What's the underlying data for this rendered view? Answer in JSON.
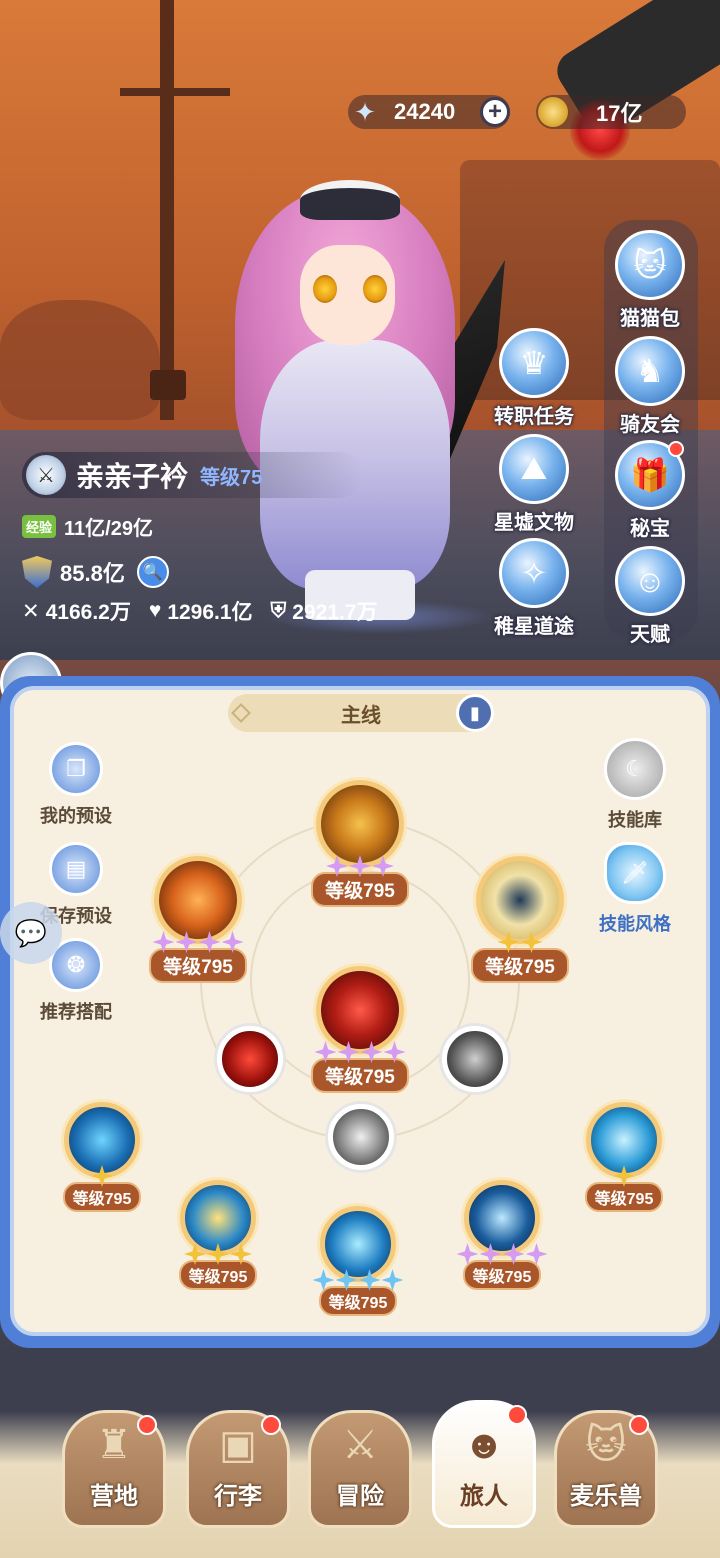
{
  "resources": {
    "stars": "24240",
    "gold": "17亿"
  },
  "right_menu": [
    {
      "label": "猫猫包",
      "icon": "cat-bag-icon",
      "badge": false
    },
    {
      "label": "骑友会",
      "icon": "horse-icon",
      "badge": false
    },
    {
      "label": "秘宝",
      "icon": "treasure-chest-icon",
      "badge": true
    },
    {
      "label": "天赋",
      "icon": "brain-head-icon",
      "badge": false
    }
  ],
  "mid_menu": [
    {
      "label": "转职任务",
      "icon": "crown-icon"
    },
    {
      "label": "星墟文物",
      "icon": "mountain-sword-icon"
    },
    {
      "label": "稚星道途",
      "icon": "star-path-icon"
    }
  ],
  "character": {
    "name": "亲亲子衿",
    "level": "等级75",
    "exp_tag": "经验",
    "exp": "11亿/29亿",
    "power": "85.8亿",
    "attack": "4166.2万",
    "hp": "1296.1亿",
    "defense": "2921.7万"
  },
  "panel": {
    "tab_title": "主线",
    "left_buttons": [
      {
        "label": "我的预设",
        "icon": "preset-cards-icon"
      },
      {
        "label": "保存预设",
        "icon": "save-disk-icon"
      },
      {
        "label": "推荐搭配",
        "icon": "recommend-combo-icon"
      }
    ],
    "right_buttons": [
      {
        "label": "技能库",
        "icon": "moon-skill-library-icon"
      },
      {
        "label": "技能风格",
        "icon": "sword-style-icon"
      }
    ]
  },
  "skills": {
    "top": {
      "level": "等级795",
      "stars": 3,
      "star_color": "p"
    },
    "upper_left": {
      "level": "等级795",
      "stars": 4,
      "star_color": "p"
    },
    "upper_right": {
      "level": "等级795",
      "stars": 2,
      "star_color": "g"
    },
    "center": {
      "level": "等级795",
      "stars": 4,
      "star_color": "p"
    },
    "left_small_level": "",
    "lower_left": {
      "level": "等级795",
      "stars": 1,
      "star_color": "g"
    },
    "lower_right": {
      "level": "等级795",
      "stars": 1,
      "star_color": "g"
    },
    "bottom_left": {
      "level": "等级795",
      "stars": 3,
      "star_color": "g"
    },
    "bottom_center": {
      "level": "等级795",
      "stars": 4,
      "star_color": "b"
    },
    "bottom_right": {
      "level": "等级795",
      "stars": 4,
      "star_color": "p"
    }
  },
  "nav": [
    {
      "label": "营地",
      "icon": "castle-icon",
      "badge": true,
      "active": false
    },
    {
      "label": "行李",
      "icon": "backpack-icon",
      "badge": true,
      "active": false
    },
    {
      "label": "冒险",
      "icon": "crossed-swords-icon",
      "badge": false,
      "active": false
    },
    {
      "label": "旅人",
      "icon": "traveler-portrait-icon",
      "badge": true,
      "active": true
    },
    {
      "label": "麦乐兽",
      "icon": "cat-face-icon",
      "badge": true,
      "active": false
    }
  ]
}
